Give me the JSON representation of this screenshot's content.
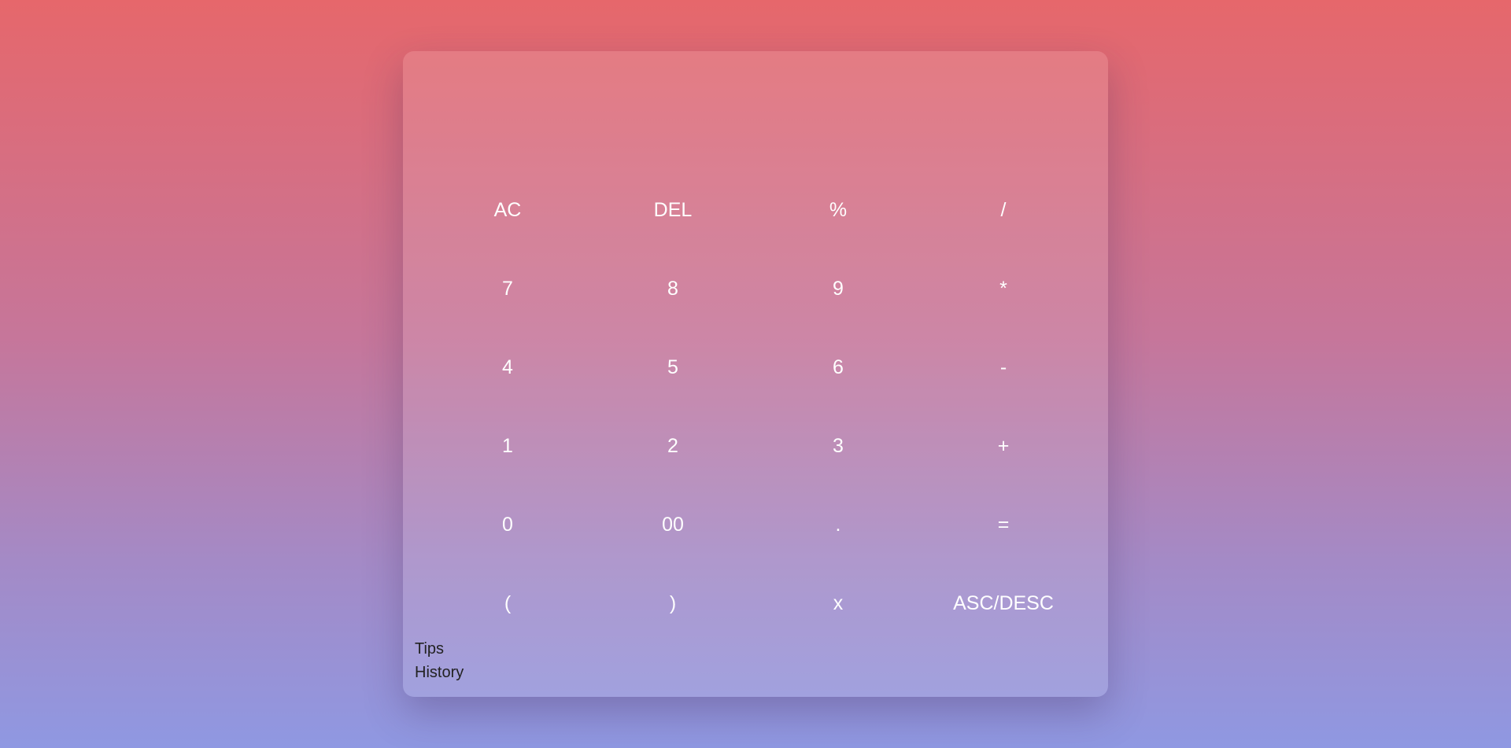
{
  "display": {
    "value": ""
  },
  "keys": [
    "AC",
    "DEL",
    "%",
    "/",
    "7",
    "8",
    "9",
    "*",
    "4",
    "5",
    "6",
    "-",
    "1",
    "2",
    "3",
    "+",
    "0",
    "00",
    ".",
    "=",
    "(",
    ")",
    "x",
    "ASC/DESC"
  ],
  "links": {
    "tips": "Tips",
    "history": "History"
  },
  "colors": {
    "bg_top": "#e6676b",
    "bg_bottom": "#8f98e2",
    "key_text": "#ffffff"
  }
}
